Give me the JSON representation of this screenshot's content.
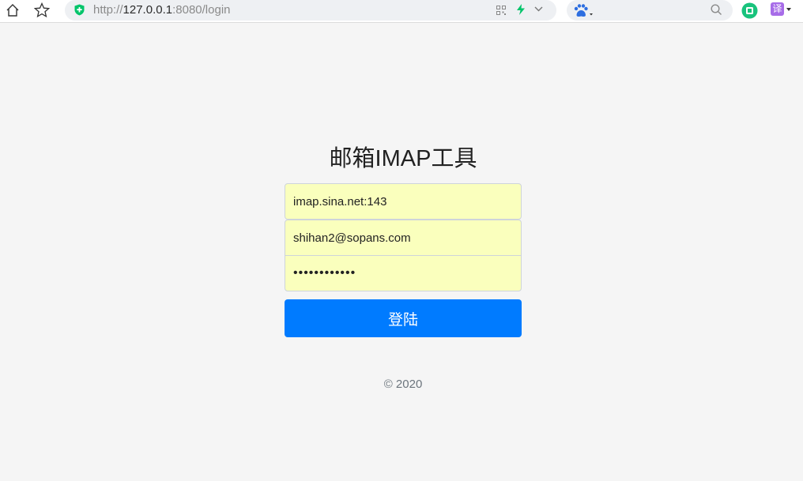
{
  "browser": {
    "url_prefix": "http://",
    "url_host": "127.0.0.1",
    "url_rest": ":8080/login",
    "translate_label": "译",
    "accent": "#00c46a"
  },
  "login": {
    "title": "邮箱IMAP工具",
    "server_value": "imap.sina.net:143",
    "email_value": "shihan2@sopans.com",
    "password_value": "••••••••••••",
    "submit_label": "登陆",
    "button_color": "#007bff",
    "field_fill": "#faffbd"
  },
  "footer": {
    "copyright": "© 2020"
  }
}
